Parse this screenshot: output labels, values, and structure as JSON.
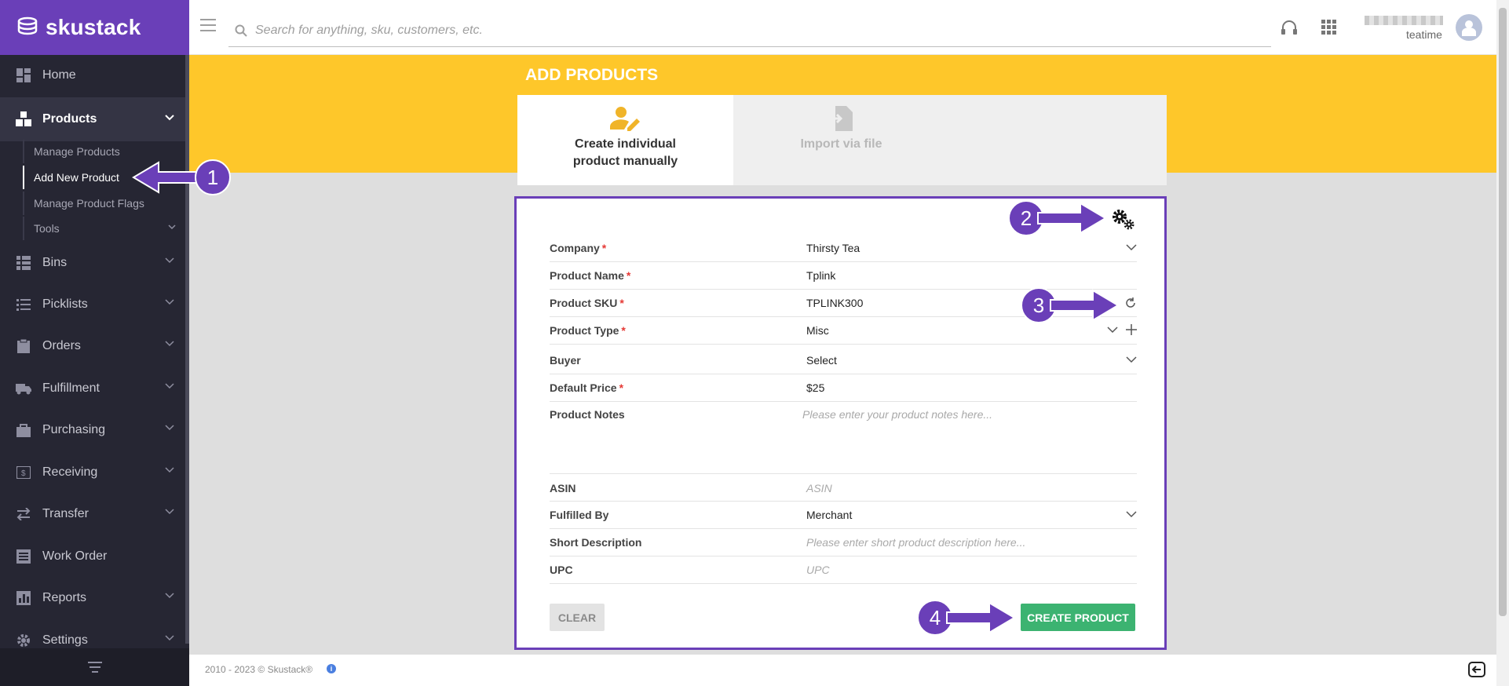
{
  "brand": {
    "name": "skustack",
    "color": "#6a3fb8"
  },
  "search": {
    "placeholder": "Search for anything, sku, customers, etc."
  },
  "user": {
    "name": "teatime"
  },
  "sidebar": {
    "items": [
      {
        "label": "Home",
        "icon": "dashboard-icon"
      },
      {
        "label": "Products",
        "icon": "boxes-icon"
      },
      {
        "label": "Bins",
        "icon": "bins-icon"
      },
      {
        "label": "Picklists",
        "icon": "list-icon"
      },
      {
        "label": "Orders",
        "icon": "clipboard-icon"
      },
      {
        "label": "Fulfillment",
        "icon": "truck-icon"
      },
      {
        "label": "Purchasing",
        "icon": "bag-icon"
      },
      {
        "label": "Receiving",
        "icon": "receiving-icon"
      },
      {
        "label": "Transfer",
        "icon": "transfer-icon"
      },
      {
        "label": "Work Order",
        "icon": "work-order-icon"
      },
      {
        "label": "Reports",
        "icon": "chart-icon"
      },
      {
        "label": "Settings",
        "icon": "gear-icon"
      }
    ],
    "sub_items": [
      {
        "label": "Manage Products"
      },
      {
        "label": "Add New Product"
      },
      {
        "label": "Manage Product Flags"
      },
      {
        "label": "Tools"
      }
    ]
  },
  "page": {
    "title": "ADD PRODUCTS"
  },
  "tabs": [
    {
      "label": "Create individual product manually",
      "icon": "person-edit-icon"
    },
    {
      "label": "Import via file",
      "icon": "file-import-icon"
    }
  ],
  "form": {
    "company": {
      "label": "Company",
      "value": "Thirsty Tea"
    },
    "product_name": {
      "label": "Product Name",
      "value": "Tplink"
    },
    "product_sku": {
      "label": "Product SKU",
      "value": "TPLINK300"
    },
    "product_type": {
      "label": "Product Type",
      "value": "Misc"
    },
    "buyer": {
      "label": "Buyer",
      "value": "Select"
    },
    "default_price": {
      "label": "Default Price",
      "value": "$25"
    },
    "product_notes": {
      "label": "Product Notes",
      "placeholder": "Please enter your product notes here..."
    },
    "asin": {
      "label": "ASIN",
      "placeholder": "ASIN"
    },
    "fulfilled_by": {
      "label": "Fulfilled By",
      "value": "Merchant"
    },
    "short_description": {
      "label": "Short Description",
      "placeholder": "Please enter short product description here..."
    },
    "upc": {
      "label": "UPC",
      "placeholder": "UPC"
    },
    "required_mark": "*",
    "clear_label": "CLEAR",
    "create_label": "CREATE PRODUCT"
  },
  "footer": {
    "copyright": "2010 - 2023 © Skustack®",
    "info_glyph": "i"
  },
  "annotations": [
    "1",
    "2",
    "3",
    "4"
  ],
  "colors": {
    "banner": "#fec72a",
    "sidebar": "#262633",
    "create_button": "#3cb371",
    "required": "#e53935"
  }
}
